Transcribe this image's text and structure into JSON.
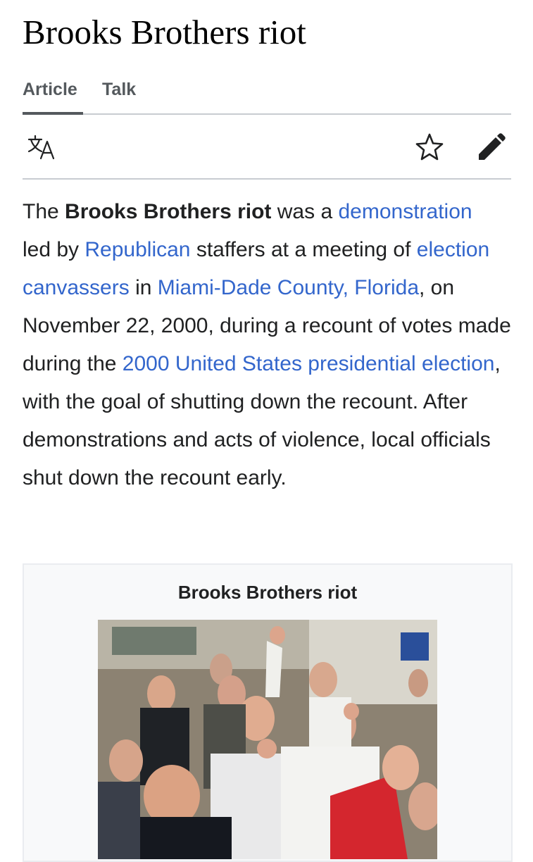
{
  "article": {
    "title": "Brooks Brothers riot"
  },
  "tabs": [
    {
      "label": "Article",
      "active": true
    },
    {
      "label": "Talk",
      "active": false
    }
  ],
  "toolbar": {
    "icons": [
      "language-icon",
      "star-icon",
      "edit-pencil-icon"
    ]
  },
  "lead": {
    "t1": "The ",
    "bold": "Brooks Brothers riot",
    "t2": " was a ",
    "link_demonstration": "demonstration",
    "t3": " led by ",
    "link_republican": "Republican",
    "t4": " staffers at a meeting of ",
    "link_canvassers": "election canvassers",
    "t5": " in ",
    "link_miami": "Miami-Dade County, Florida",
    "t6": ", on November 22, 2000, during a recount of votes made during the ",
    "link_election": "2000 United States presidential election",
    "t7": ", with the goal of shutting down the recount. After demonstrations and acts of violence, local officials shut down the recount early."
  },
  "infobox": {
    "caption": "Brooks Brothers riot"
  },
  "colors": {
    "link": "#3366cc",
    "text": "#202122",
    "tab_text": "#54595d",
    "border": "#c8ccd1",
    "infobox_bg": "#f8f9fa"
  }
}
